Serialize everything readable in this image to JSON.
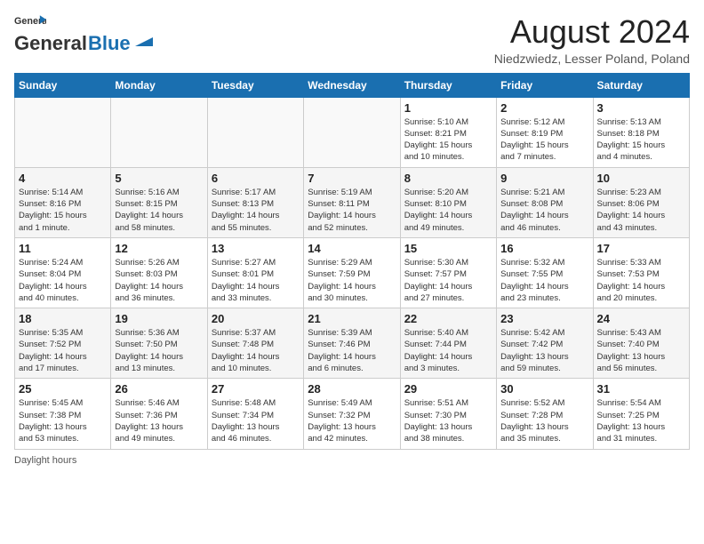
{
  "header": {
    "logo_line1": "General",
    "logo_line2": "Blue",
    "title": "August 2024",
    "subtitle": "Niedzwiedz, Lesser Poland, Poland"
  },
  "days_of_week": [
    "Sunday",
    "Monday",
    "Tuesday",
    "Wednesday",
    "Thursday",
    "Friday",
    "Saturday"
  ],
  "weeks": [
    [
      {
        "day": "",
        "info": ""
      },
      {
        "day": "",
        "info": ""
      },
      {
        "day": "",
        "info": ""
      },
      {
        "day": "",
        "info": ""
      },
      {
        "day": "1",
        "info": "Sunrise: 5:10 AM\nSunset: 8:21 PM\nDaylight: 15 hours\nand 10 minutes."
      },
      {
        "day": "2",
        "info": "Sunrise: 5:12 AM\nSunset: 8:19 PM\nDaylight: 15 hours\nand 7 minutes."
      },
      {
        "day": "3",
        "info": "Sunrise: 5:13 AM\nSunset: 8:18 PM\nDaylight: 15 hours\nand 4 minutes."
      }
    ],
    [
      {
        "day": "4",
        "info": "Sunrise: 5:14 AM\nSunset: 8:16 PM\nDaylight: 15 hours\nand 1 minute."
      },
      {
        "day": "5",
        "info": "Sunrise: 5:16 AM\nSunset: 8:15 PM\nDaylight: 14 hours\nand 58 minutes."
      },
      {
        "day": "6",
        "info": "Sunrise: 5:17 AM\nSunset: 8:13 PM\nDaylight: 14 hours\nand 55 minutes."
      },
      {
        "day": "7",
        "info": "Sunrise: 5:19 AM\nSunset: 8:11 PM\nDaylight: 14 hours\nand 52 minutes."
      },
      {
        "day": "8",
        "info": "Sunrise: 5:20 AM\nSunset: 8:10 PM\nDaylight: 14 hours\nand 49 minutes."
      },
      {
        "day": "9",
        "info": "Sunrise: 5:21 AM\nSunset: 8:08 PM\nDaylight: 14 hours\nand 46 minutes."
      },
      {
        "day": "10",
        "info": "Sunrise: 5:23 AM\nSunset: 8:06 PM\nDaylight: 14 hours\nand 43 minutes."
      }
    ],
    [
      {
        "day": "11",
        "info": "Sunrise: 5:24 AM\nSunset: 8:04 PM\nDaylight: 14 hours\nand 40 minutes."
      },
      {
        "day": "12",
        "info": "Sunrise: 5:26 AM\nSunset: 8:03 PM\nDaylight: 14 hours\nand 36 minutes."
      },
      {
        "day": "13",
        "info": "Sunrise: 5:27 AM\nSunset: 8:01 PM\nDaylight: 14 hours\nand 33 minutes."
      },
      {
        "day": "14",
        "info": "Sunrise: 5:29 AM\nSunset: 7:59 PM\nDaylight: 14 hours\nand 30 minutes."
      },
      {
        "day": "15",
        "info": "Sunrise: 5:30 AM\nSunset: 7:57 PM\nDaylight: 14 hours\nand 27 minutes."
      },
      {
        "day": "16",
        "info": "Sunrise: 5:32 AM\nSunset: 7:55 PM\nDaylight: 14 hours\nand 23 minutes."
      },
      {
        "day": "17",
        "info": "Sunrise: 5:33 AM\nSunset: 7:53 PM\nDaylight: 14 hours\nand 20 minutes."
      }
    ],
    [
      {
        "day": "18",
        "info": "Sunrise: 5:35 AM\nSunset: 7:52 PM\nDaylight: 14 hours\nand 17 minutes."
      },
      {
        "day": "19",
        "info": "Sunrise: 5:36 AM\nSunset: 7:50 PM\nDaylight: 14 hours\nand 13 minutes."
      },
      {
        "day": "20",
        "info": "Sunrise: 5:37 AM\nSunset: 7:48 PM\nDaylight: 14 hours\nand 10 minutes."
      },
      {
        "day": "21",
        "info": "Sunrise: 5:39 AM\nSunset: 7:46 PM\nDaylight: 14 hours\nand 6 minutes."
      },
      {
        "day": "22",
        "info": "Sunrise: 5:40 AM\nSunset: 7:44 PM\nDaylight: 14 hours\nand 3 minutes."
      },
      {
        "day": "23",
        "info": "Sunrise: 5:42 AM\nSunset: 7:42 PM\nDaylight: 13 hours\nand 59 minutes."
      },
      {
        "day": "24",
        "info": "Sunrise: 5:43 AM\nSunset: 7:40 PM\nDaylight: 13 hours\nand 56 minutes."
      }
    ],
    [
      {
        "day": "25",
        "info": "Sunrise: 5:45 AM\nSunset: 7:38 PM\nDaylight: 13 hours\nand 53 minutes."
      },
      {
        "day": "26",
        "info": "Sunrise: 5:46 AM\nSunset: 7:36 PM\nDaylight: 13 hours\nand 49 minutes."
      },
      {
        "day": "27",
        "info": "Sunrise: 5:48 AM\nSunset: 7:34 PM\nDaylight: 13 hours\nand 46 minutes."
      },
      {
        "day": "28",
        "info": "Sunrise: 5:49 AM\nSunset: 7:32 PM\nDaylight: 13 hours\nand 42 minutes."
      },
      {
        "day": "29",
        "info": "Sunrise: 5:51 AM\nSunset: 7:30 PM\nDaylight: 13 hours\nand 38 minutes."
      },
      {
        "day": "30",
        "info": "Sunrise: 5:52 AM\nSunset: 7:28 PM\nDaylight: 13 hours\nand 35 minutes."
      },
      {
        "day": "31",
        "info": "Sunrise: 5:54 AM\nSunset: 7:25 PM\nDaylight: 13 hours\nand 31 minutes."
      }
    ]
  ],
  "footer": {
    "daylight_label": "Daylight hours"
  }
}
